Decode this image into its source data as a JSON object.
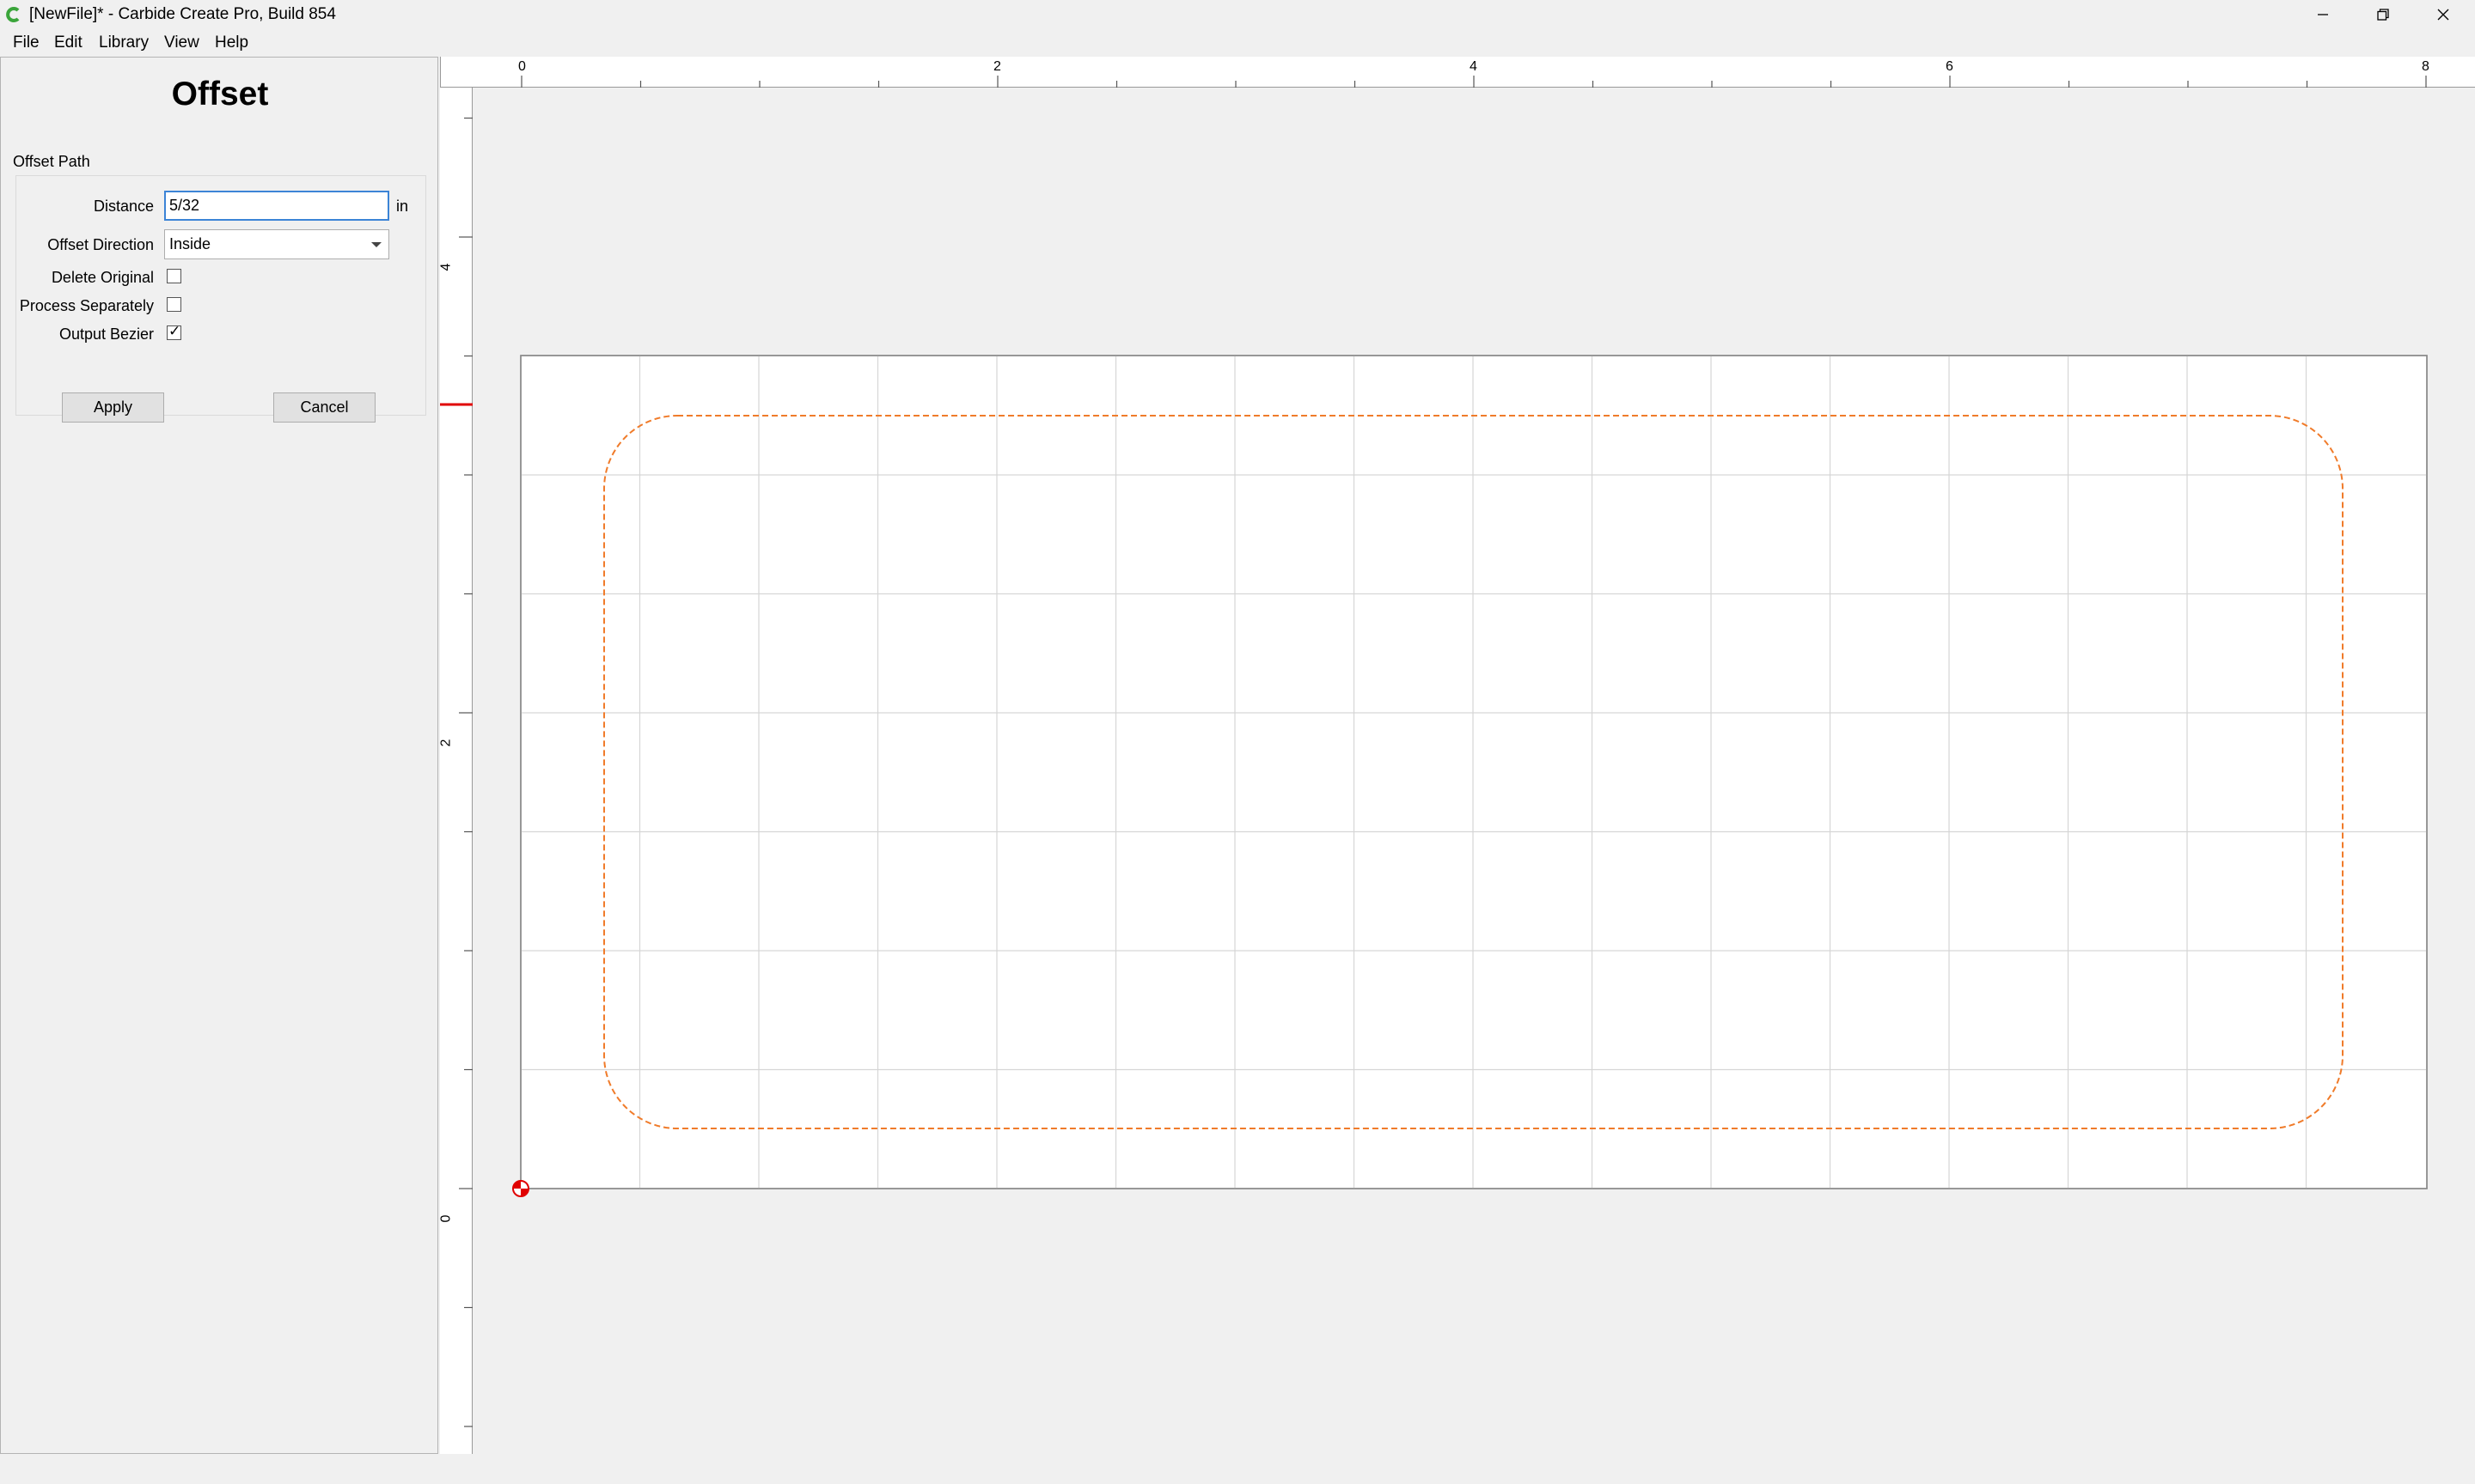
{
  "window": {
    "title": "[NewFile]* - Carbide Create Pro, Build 854",
    "icon": "carbide-create-icon",
    "controls": [
      "minimize-icon",
      "restore-icon",
      "close-icon"
    ]
  },
  "menu": {
    "items": [
      {
        "label": "File"
      },
      {
        "label": "Edit"
      },
      {
        "label": "Library"
      },
      {
        "label": "View"
      },
      {
        "label": "Help"
      }
    ]
  },
  "panel": {
    "title": "Offset",
    "group_label": "Offset Path",
    "distance": {
      "label": "Distance",
      "value": "5/32",
      "unit": "in"
    },
    "direction": {
      "label": "Offset Direction",
      "value": "Inside"
    },
    "delete_original": {
      "label": "Delete Original",
      "checked": false
    },
    "process_separately": {
      "label": "Process Separately",
      "checked": false
    },
    "output_bezier": {
      "label": "Output Bezier",
      "checked": true,
      "glyph": "✓"
    },
    "apply_label": "Apply",
    "cancel_label": "Cancel"
  },
  "rulers": {
    "horizontal_labels": [
      "0",
      "2",
      "4",
      "6",
      "8"
    ],
    "vertical_labels": [
      "4",
      "2",
      "0"
    ]
  },
  "colors": {
    "offset_path": "#f07b2a",
    "origin_marker": "#e00000",
    "focus": "#3c84d6"
  }
}
